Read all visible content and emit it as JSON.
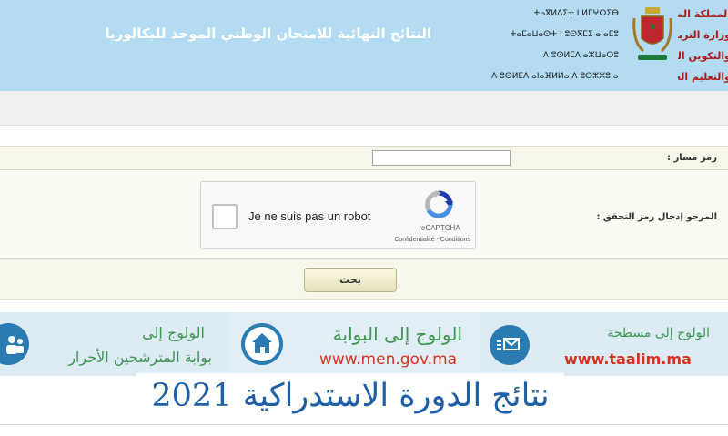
{
  "header": {
    "title": "النتائج النهائية للامتحان الوطني الموحد للبكالوريا",
    "tifinagh_lines": [
      "ⵜⴰⴳⵍⴷⵉⵜ ⵏ ⵍⵎⵖⵔⵉⴱ",
      "ⵜⴰⵎⴰⵡⴰⵙⵜ ⵏ ⵓⵙⴳⵎⵉ ⴰⵏⴰⵎⵓ",
      "ⴷ ⵓⵙⵍⵎⴷ ⴰⵣⵡⴰⵔⵓ",
      "ⴷ ⵓⵙⵍⵎⴷ ⴰⵏⴰⴼⵍⵍⴰ ⴷ ⵓⵔⵣⵣⵓ ⴰⵎⵓⵙⵙⵏ"
    ],
    "arabic_lines": [
      "المملكة المغربية",
      "وزارة التربية الوطنية",
      "والتكوين المهني",
      "والتعليم العالي والبحث العلمي"
    ]
  },
  "form": {
    "massar_label": "رمز مسار :",
    "massar_value": "",
    "verify_label": "المرجو إدخال رمز التحقق :",
    "captcha": {
      "checkbox_label": "Je ne suis pas un robot",
      "brand": "reCAPTCHA",
      "links": "Confidentialité - Conditions"
    },
    "search_button": "بحث"
  },
  "banner": {
    "left_line1": "الولوج إلى",
    "left_line2": "بوابة المترشحين الأحرار",
    "mid_line1": "الولوج إلى البوابة",
    "mid_url": "www.men.gov.ma",
    "right_line1": "الولوج إلى مسطحة",
    "right_url": "www.taalim.ma",
    "big_title": "نتائج الدورة الاستدراكية 2021"
  },
  "colors": {
    "header_bg": "#b3dcf3",
    "accent_blue": "#2a7bb2",
    "green_text": "#3e9651",
    "red_url": "#d6321f",
    "title_blue": "#1f5fa6"
  }
}
